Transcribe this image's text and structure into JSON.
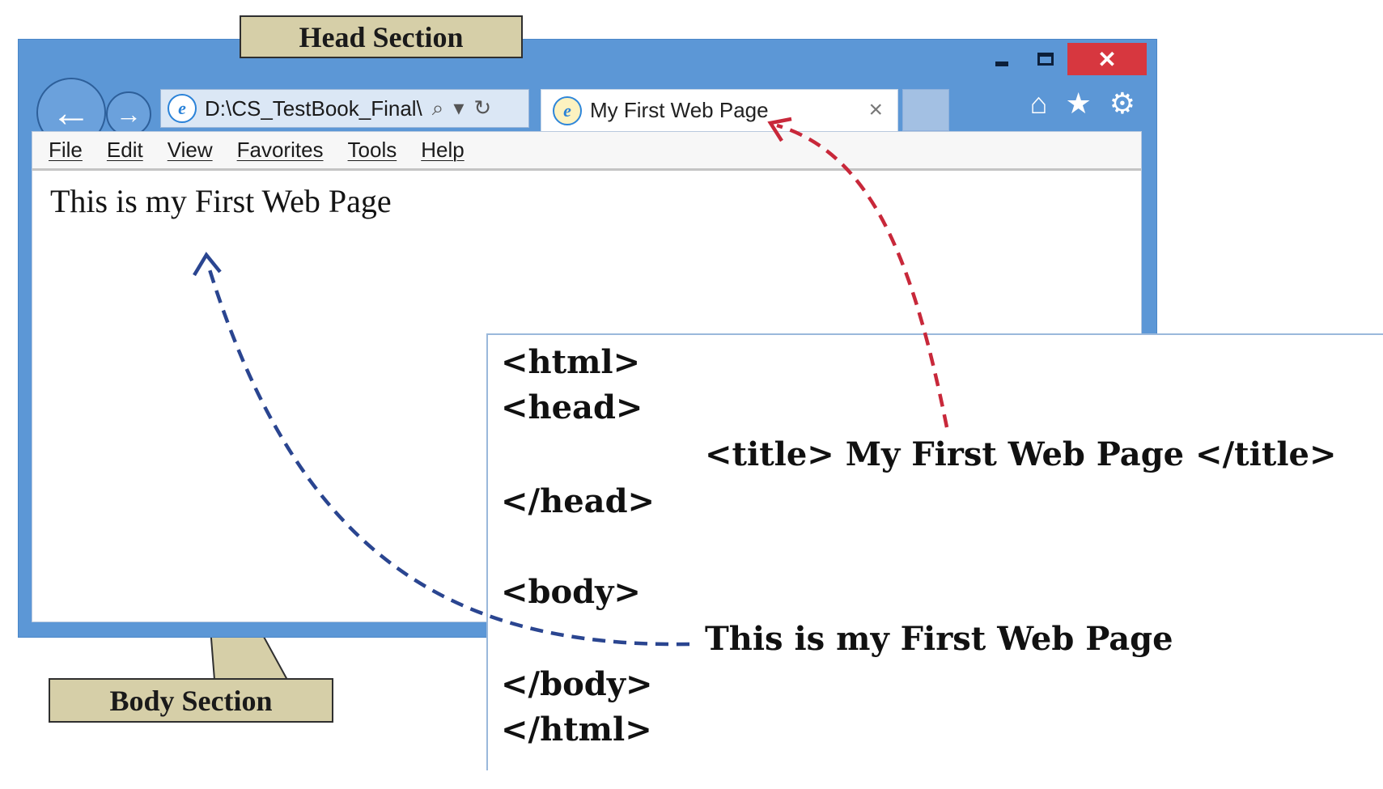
{
  "browser": {
    "address": "D:\\CS_TestBook_Final\\",
    "tab_title": "My First Web Page",
    "tab_close": "×",
    "menu": [
      "File",
      "Edit",
      "View",
      "Favorites",
      "Tools",
      "Help"
    ],
    "page_text": "This is my First Web Page",
    "window_controls": {
      "minimize": "‒",
      "close": "✕"
    },
    "icons": [
      "back-arrow-icon",
      "forward-arrow-icon",
      "ie-icon",
      "search-icon",
      "refresh-icon",
      "home-icon",
      "star-icon",
      "gear-icon"
    ]
  },
  "callouts": {
    "head": "Head Section",
    "body": "Body Section"
  },
  "code": {
    "html_open": "<html>",
    "head_open": "<head>",
    "title_line": "<title> My First Web Page </title>",
    "head_close": "</head>",
    "body_open": "<body>",
    "body_text": "This is my First Web Page",
    "body_close": "</body>",
    "html_close": "</html>"
  },
  "colors": {
    "window_frame": "#5c97d6",
    "close_button": "#d7373f",
    "callout_fill": "#d6cfa8",
    "head_arrow": "#c8283a",
    "body_arrow": "#2a4590"
  }
}
